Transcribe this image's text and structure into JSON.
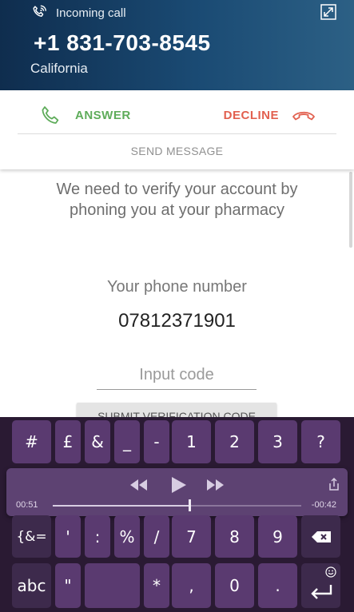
{
  "call": {
    "status_text": "Incoming call",
    "number": "+1 831-703-8545",
    "location": "California",
    "answer_label": "ANSWER",
    "decline_label": "DECLINE",
    "send_message_label": "SEND MESSAGE"
  },
  "page": {
    "verify_text": "We need to verify your account by phoning you at your pharmacy",
    "phone_label": "Your phone number",
    "phone_value": "07812371901",
    "code_placeholder": "Input code",
    "submit_label": "SUBMIT VERIFICATION CODE"
  },
  "keyboard": {
    "row1": [
      "#",
      "£",
      "&",
      "_",
      "-",
      "1",
      "2",
      "3",
      "?"
    ],
    "row2": [
      "{&=",
      "'",
      ":",
      "%",
      "/",
      "7",
      "8",
      "9"
    ],
    "row3": [
      "abc",
      "\"",
      "",
      "*",
      ",",
      "0",
      "."
    ],
    "media": {
      "time_elapsed": "00:51",
      "time_remaining": "-00:42",
      "progress": 0.55
    }
  },
  "colors": {
    "answer": "#5eac5a",
    "decline": "#e2604f",
    "keyboard_bg": "#2a1a33",
    "key_bg": "#5a3a70"
  }
}
